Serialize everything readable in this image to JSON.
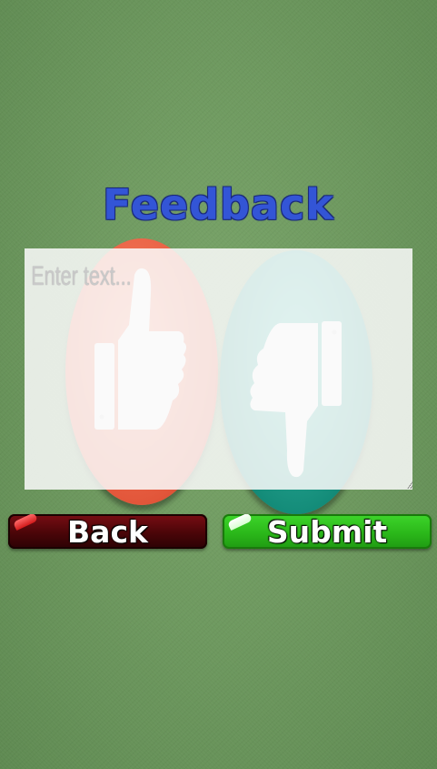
{
  "screen": {
    "title": "Feedback"
  },
  "feedback_input": {
    "placeholder": "Enter text..."
  },
  "vote_options": {
    "up_icon": "thumbs-up-icon",
    "down_icon": "thumbs-down-icon"
  },
  "buttons": {
    "back_label": "Back",
    "submit_label": "Submit"
  },
  "colors": {
    "title": "#3355d6",
    "thumbs_up_button": "#e2563a",
    "thumbs_down_button": "#148c79",
    "back_button": "#4a0508",
    "submit_button": "#2bb81a",
    "background": "#6f9a60"
  }
}
